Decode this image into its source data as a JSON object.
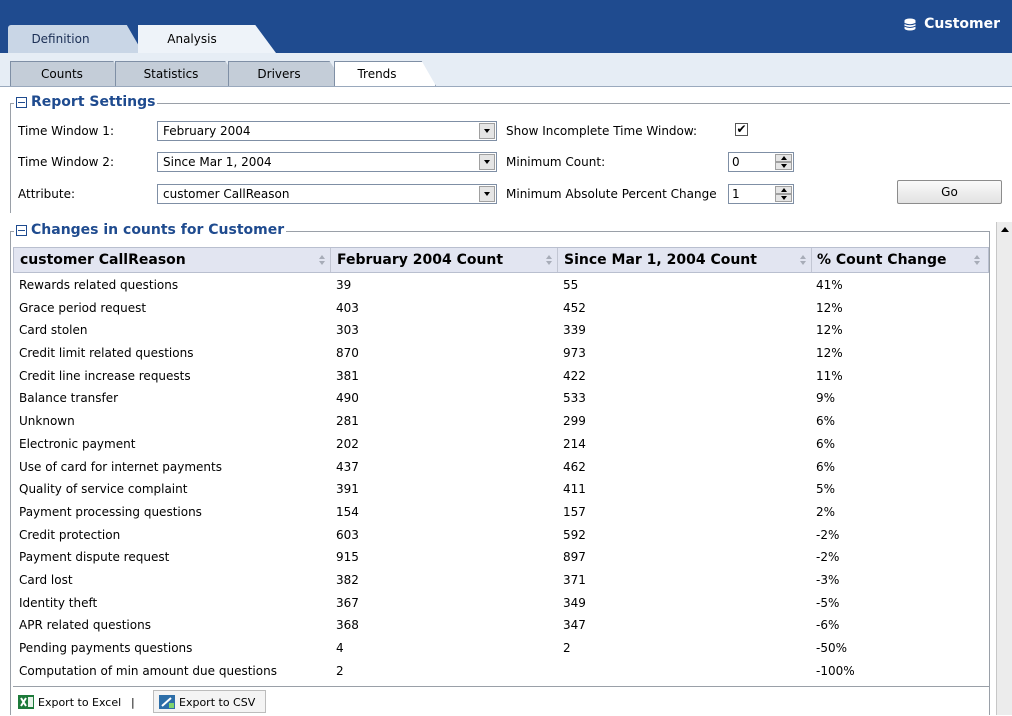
{
  "header": {
    "entity_label": "Customer",
    "entity_icon": "database-icon",
    "main_tabs": [
      {
        "label": "Definition",
        "active": false
      },
      {
        "label": "Analysis",
        "active": true
      }
    ],
    "sub_tabs": [
      {
        "label": "Counts",
        "active": false
      },
      {
        "label": "Statistics",
        "active": false
      },
      {
        "label": "Drivers",
        "active": false
      },
      {
        "label": "Trends",
        "active": true
      }
    ],
    "colors": {
      "header_bg": "#1f4b8f",
      "section_title": "#1f4b8f"
    }
  },
  "report_settings": {
    "title": "Report Settings",
    "time_window_1": {
      "label": "Time Window 1:",
      "value": "February 2004"
    },
    "time_window_2": {
      "label": "Time Window 2:",
      "value": "Since Mar 1, 2004"
    },
    "attribute": {
      "label": "Attribute:",
      "value": "customer CallReason"
    },
    "show_incomplete": {
      "label": "Show Incomplete Time Window:",
      "checked": true,
      "mark": "✔"
    },
    "minimum_count": {
      "label": "Minimum Count:",
      "value": "0"
    },
    "min_abs_pct_change": {
      "label": "Minimum Absolute Percent Change",
      "value": "1"
    },
    "go_label": "Go"
  },
  "changes": {
    "title": "Changes in counts for Customer",
    "columns": [
      "customer CallReason",
      "February 2004 Count",
      "Since Mar 1, 2004 Count",
      "% Count Change"
    ],
    "rows": [
      [
        "Rewards related questions",
        "39",
        "55",
        "41%"
      ],
      [
        "Grace period request",
        "403",
        "452",
        "12%"
      ],
      [
        "Card stolen",
        "303",
        "339",
        "12%"
      ],
      [
        "Credit limit related questions",
        "870",
        "973",
        "12%"
      ],
      [
        "Credit line increase requests",
        "381",
        "422",
        "11%"
      ],
      [
        "Balance transfer",
        "490",
        "533",
        "9%"
      ],
      [
        "Unknown",
        "281",
        "299",
        "6%"
      ],
      [
        "Electronic payment",
        "202",
        "214",
        "6%"
      ],
      [
        "Use of card for internet payments",
        "437",
        "462",
        "6%"
      ],
      [
        "Quality of service complaint",
        "391",
        "411",
        "5%"
      ],
      [
        "Payment processing questions",
        "154",
        "157",
        "2%"
      ],
      [
        "Credit protection",
        "603",
        "592",
        "-2%"
      ],
      [
        "Payment dispute request",
        "915",
        "897",
        "-2%"
      ],
      [
        "Card lost",
        "382",
        "371",
        "-3%"
      ],
      [
        "Identity theft",
        "367",
        "349",
        "-5%"
      ],
      [
        "APR related questions",
        "368",
        "347",
        "-6%"
      ],
      [
        "Pending payments questions",
        "4",
        "2",
        "-50%"
      ],
      [
        "Computation of min amount due questions",
        "2",
        "",
        "-100%"
      ]
    ]
  },
  "export": {
    "excel_label": "Export to Excel",
    "separator": "|",
    "csv_label": "Export to CSV"
  }
}
